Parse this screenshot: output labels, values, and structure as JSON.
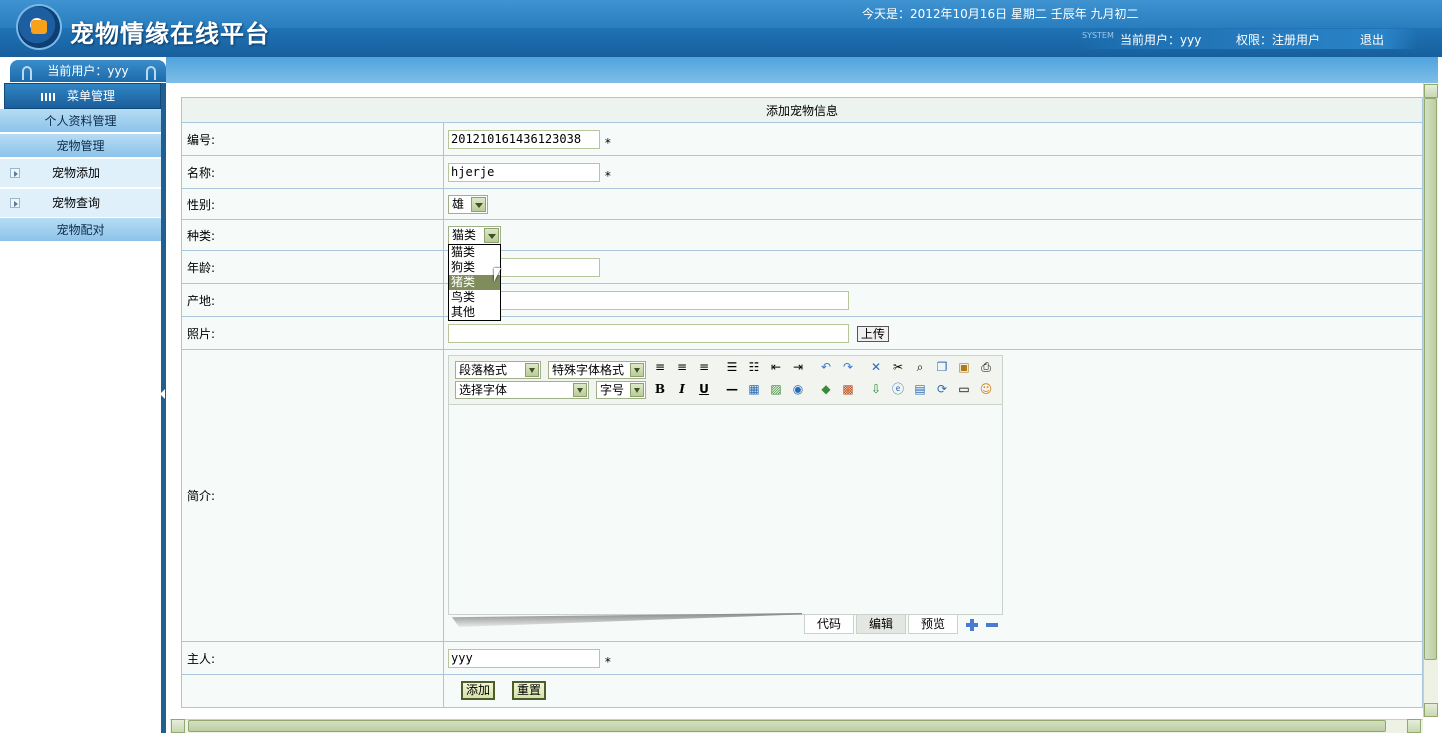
{
  "header": {
    "app_title": "宠物情缘在线平台",
    "date_text": "今天是：2012年10月16日 星期二 壬辰年 九月初二",
    "system_tag": "SYSTEM",
    "current_user": "当前用户：yyy",
    "permission": "权限：注册用户",
    "logout": "退出"
  },
  "sidebar": {
    "user_label": "当前用户：yyy",
    "menu_title": "菜单管理",
    "groups": [
      {
        "label": "个人资料管理"
      },
      {
        "label": "宠物管理"
      },
      {
        "label": "宠物配对"
      }
    ],
    "items": [
      {
        "label": "宠物添加"
      },
      {
        "label": "宠物查询"
      }
    ]
  },
  "form": {
    "title": "添加宠物信息",
    "fields": {
      "id": {
        "label": "编号:",
        "value": "201210161436123038",
        "required": "*"
      },
      "name": {
        "label": "名称:",
        "value": "hjerje",
        "required": "*"
      },
      "gender": {
        "label": "性别:",
        "value": "雄"
      },
      "species": {
        "label": "种类:",
        "value": "猫类"
      },
      "age": {
        "label": "年龄:",
        "value": ""
      },
      "origin": {
        "label": "产地:",
        "value": ""
      },
      "photo": {
        "label": "照片:",
        "value": "",
        "upload": "上传"
      },
      "intro": {
        "label": "简介:"
      },
      "owner": {
        "label": "主人:",
        "value": "yyy",
        "required": "*"
      }
    },
    "species_options": [
      "猫类",
      "狗类",
      "猪类",
      "鸟类",
      "其他"
    ],
    "species_highlighted": "猪类",
    "buttons": {
      "submit": "添加",
      "reset": "重置"
    }
  },
  "editor": {
    "paragraph_format": "段落格式",
    "special_font_format": "特殊字体格式",
    "font_select": "选择字体",
    "font_size": "字号",
    "bold": "B",
    "italic": "I",
    "underline": "U",
    "tabs": [
      "代码",
      "编辑",
      "预览"
    ],
    "active_tab": "编辑"
  }
}
